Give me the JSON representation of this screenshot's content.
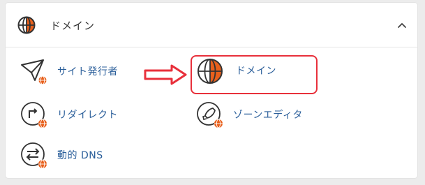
{
  "section": {
    "title": "ドメイン",
    "header_icon": "globe-icon",
    "collapse_icon": "chevron-up-icon"
  },
  "items": [
    {
      "id": "site-publisher",
      "label": "サイト発行者",
      "icon": "paper-plane-globe-icon"
    },
    {
      "id": "domains",
      "label": "ドメイン",
      "icon": "globe-icon"
    },
    {
      "id": "redirects",
      "label": "リダイレクト",
      "icon": "redirect-globe-icon"
    },
    {
      "id": "zone-editor",
      "label": "ゾーンエディタ",
      "icon": "rocket-globe-icon"
    },
    {
      "id": "dynamic-dns",
      "label": "動的 DNS",
      "icon": "exchange-arrows-globe-icon"
    }
  ],
  "annotation": {
    "arrow_icon": "right-arrow-icon",
    "highlight_color": "#e8303b"
  },
  "colors": {
    "accent": "#e8601c",
    "link": "#2a5e9a",
    "icon_stroke": "#333333"
  }
}
